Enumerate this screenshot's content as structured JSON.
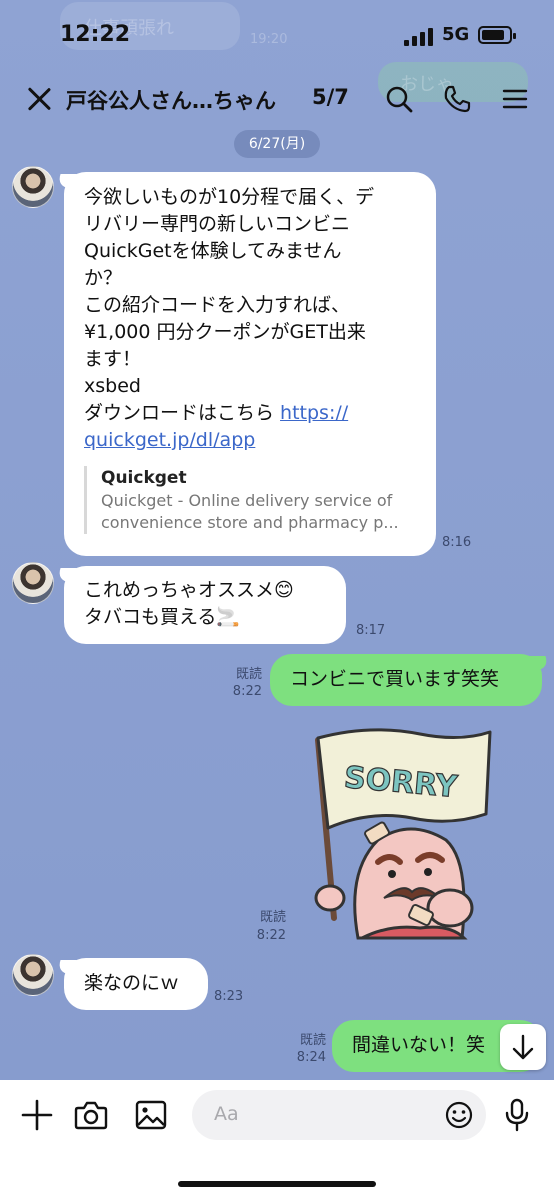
{
  "status_bar": {
    "time": "12:22",
    "network": "5G"
  },
  "background_ghost": {
    "text1": "仕事頑張れ",
    "time1": "19:20",
    "text2": "おじゃ"
  },
  "header": {
    "title": "戸谷公人さん…ちゃん",
    "count": "5/7"
  },
  "date_separator": "6/27(月)",
  "messages": [
    {
      "side": "incoming",
      "lines": [
        "今欲しいものが10分程で届く、デ",
        "リバリー専門の新しいコンビニ",
        "QuickGetを体験してみません",
        "か？",
        "この紹介コードを入力すれば、",
        "¥1,000 円分クーポンがGET出来",
        "ます！",
        "xsbed",
        "ダウンロードはこちら "
      ],
      "link_part1": "https://",
      "link_part2": "quickget.jp/dl/app",
      "preview_title": "Quickget",
      "preview_desc1": "Quickget - Online delivery service of",
      "preview_desc2": "convenience store and pharmacy p...",
      "time": "8:16"
    },
    {
      "side": "incoming",
      "lines": [
        "これめっちゃオススメ😊",
        "タバコも買える🚬"
      ],
      "time": "8:17"
    },
    {
      "side": "outgoing",
      "text": "コンビニで買います笑笑",
      "read": "既読",
      "time": "8:22"
    },
    {
      "side": "outgoing",
      "sticker_text": "SORRY",
      "read": "既読",
      "time": "8:22"
    },
    {
      "side": "incoming",
      "text": "楽なのにｗ",
      "time": "8:23"
    },
    {
      "side": "outgoing",
      "text": "間違いない！笑",
      "read": "既読",
      "time": "8:24"
    }
  ],
  "input": {
    "placeholder": "Aa"
  },
  "colors": {
    "chat_bg": "#8a9fcf",
    "outgoing_bubble": "#7ee07f",
    "incoming_bubble": "#ffffff",
    "link": "#3b67c9"
  },
  "icons": [
    "close-icon",
    "search-icon",
    "phone-icon",
    "menu-icon",
    "plus-icon",
    "camera-icon",
    "image-icon",
    "emoji-icon",
    "microphone-icon",
    "arrow-down-icon"
  ]
}
